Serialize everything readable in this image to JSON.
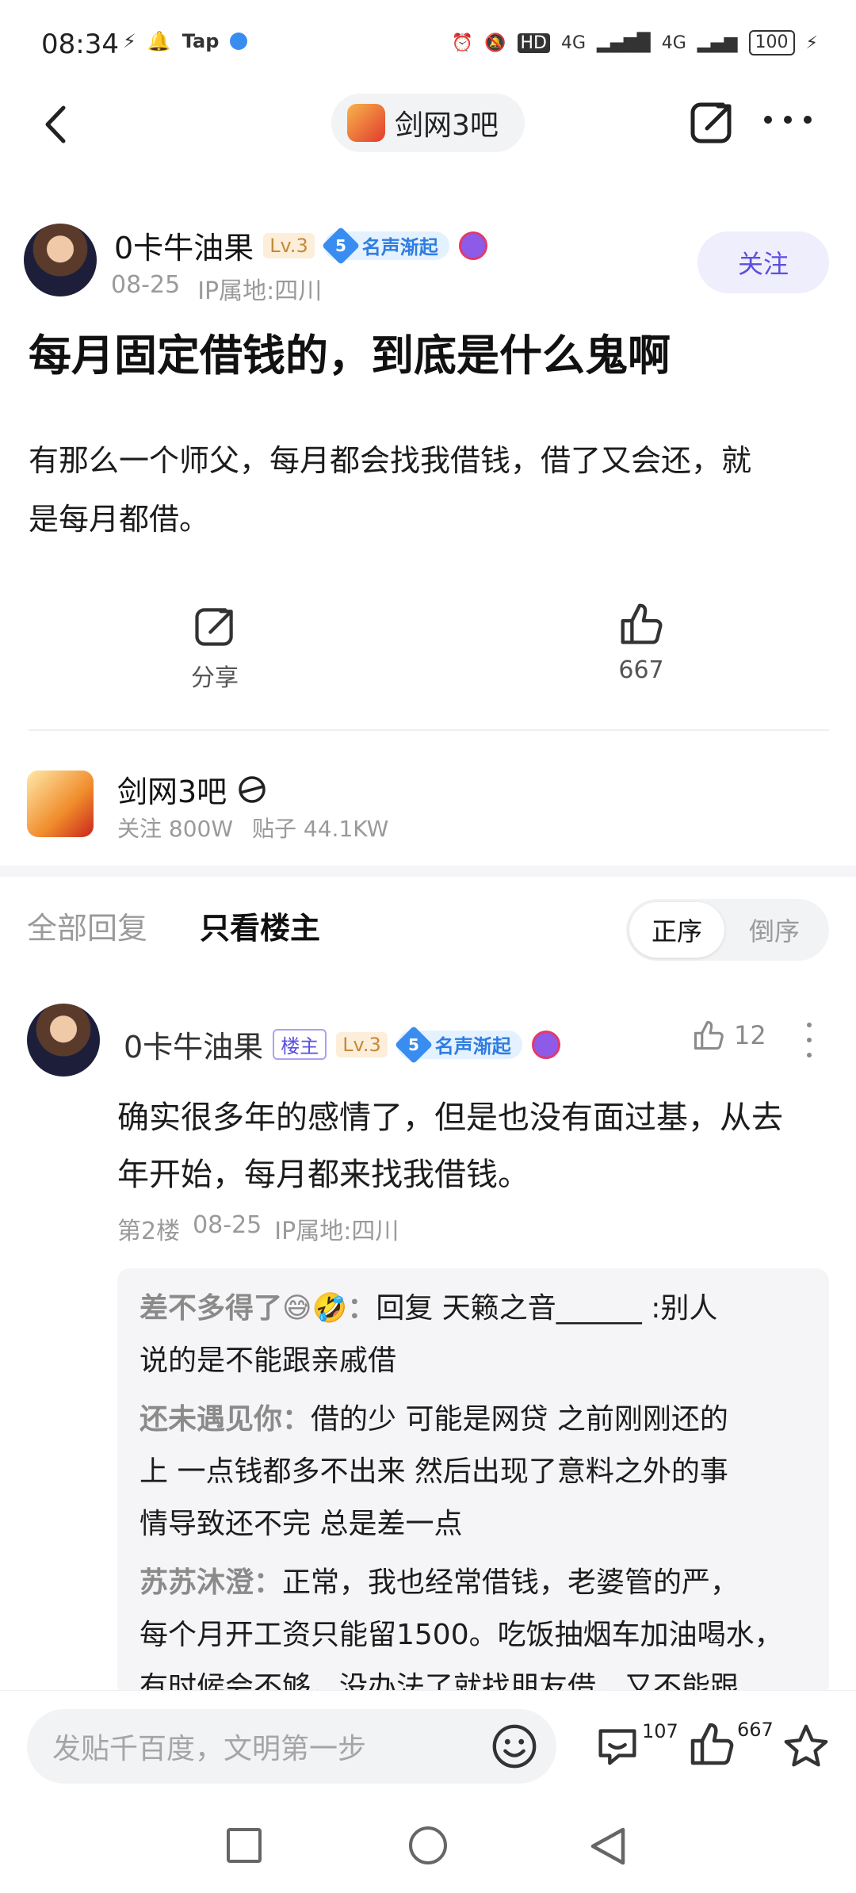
{
  "status_bar": {
    "time": "08:34",
    "tap_label": "Tap",
    "hd_label": "HD",
    "net_1": "4G",
    "net_2": "4G",
    "battery": "100"
  },
  "nav": {
    "forum_title": "剑网3吧"
  },
  "author": {
    "name": "0卡牛油果",
    "level": "Lv.3",
    "fame_num": "5",
    "fame_label": "名声渐起",
    "date": "08-25",
    "ip": "IP属地:四川",
    "follow_label": "关注"
  },
  "post": {
    "title": "每月固定借钱的，到底是什么鬼啊",
    "body_line1": "有那么一个师父，每月都会找我借钱，借了又会还，就",
    "body_line2": "是每月都借。"
  },
  "actions": {
    "share_label": "分享",
    "like_count": "667"
  },
  "forum_card": {
    "name": "剑网3吧",
    "followers": "关注 800W",
    "posts": "贴子 44.1KW"
  },
  "tabs": {
    "all": "全部回复",
    "host_only": "只看楼主",
    "sort_asc": "正序",
    "sort_desc": "倒序"
  },
  "reply": {
    "name": "0卡牛油果",
    "host_tag": "楼主",
    "level": "Lv.3",
    "fame_num": "5",
    "fame_label": "名声渐起",
    "likes": "12",
    "text_line1": "确实很多年的感情了，但是也没有面过基，从去",
    "text_line2": "年开始，每月都来找我借钱。",
    "floor": "第2楼",
    "date": "08-25",
    "ip": "IP属地:四川"
  },
  "sub_replies": [
    {
      "user": "差不多得了😅🤣：",
      "line1": "回复 天籁之音______ :别人",
      "line2": "说的是不能跟亲戚借"
    },
    {
      "user": "还未遇见你：",
      "line1": "借的少 可能是网贷 之前刚刚还的",
      "line2": "上 一点钱都多不出来 然后出现了意料之外的事",
      "line3": "情导致还不完 总是差一点"
    },
    {
      "user": "苏苏沐澄：",
      "line1": "正常，我也经常借钱，老婆管的严，",
      "line2": "每个月开工资只能留1500。吃饭抽烟车加油喝水，",
      "line3": "有时候会不够，没办法了就找朋友借，又不能跟"
    }
  ],
  "bottom": {
    "input_placeholder": "发贴千百度，文明第一步",
    "comment_count": "107",
    "like_count": "667"
  }
}
